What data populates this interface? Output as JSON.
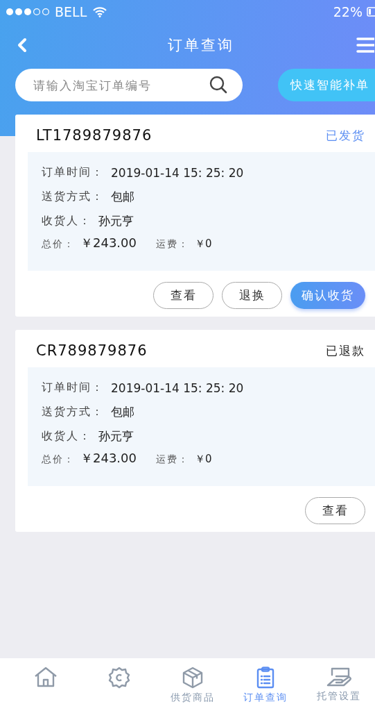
{
  "status_bar": {
    "carrier": "BELL",
    "battery": "22%"
  },
  "header": {
    "title": "订单查询"
  },
  "search": {
    "placeholder": "请输入淘宝订单编号"
  },
  "quick_button": "快速智能补单",
  "orders": [
    {
      "number": "LT1789879876",
      "status": {
        "text": "已发货",
        "color": "#5b8ef2"
      },
      "details": [
        {
          "label": "订单时间：",
          "value": "2019-01-14 15: 25: 20"
        },
        {
          "label": "送货方式：",
          "value": "包邮"
        },
        {
          "label": "收货人：",
          "value": "孙元亨"
        }
      ],
      "totals": [
        {
          "label": "总价：",
          "value": "￥243.00"
        },
        {
          "label": "运费：",
          "value": "￥0"
        }
      ],
      "buttons": [
        {
          "label": "查看",
          "kind": "outline"
        },
        {
          "label": "退换",
          "kind": "outline"
        },
        {
          "label": "确认收货",
          "kind": "primary"
        }
      ]
    },
    {
      "number": "CR789879876",
      "status": {
        "text": "已退款",
        "color": "#222222"
      },
      "details": [
        {
          "label": "订单时间：",
          "value": "2019-01-14 15: 25: 20"
        },
        {
          "label": "送货方式：",
          "value": "包邮"
        },
        {
          "label": "收货人：",
          "value": "孙元亨"
        }
      ],
      "totals": [
        {
          "label": "总价：",
          "value": "￥243.00"
        },
        {
          "label": "运费：",
          "value": "￥0"
        }
      ],
      "buttons": [
        {
          "label": "查看",
          "kind": "outline"
        }
      ]
    }
  ],
  "tab_bar": [
    {
      "selected": false
    },
    {
      "selected": false
    },
    {
      "label": "供货商品",
      "selected": false
    },
    {
      "label": "订单查询",
      "selected": true
    },
    {
      "label": "托管设置",
      "selected": false
    }
  ]
}
